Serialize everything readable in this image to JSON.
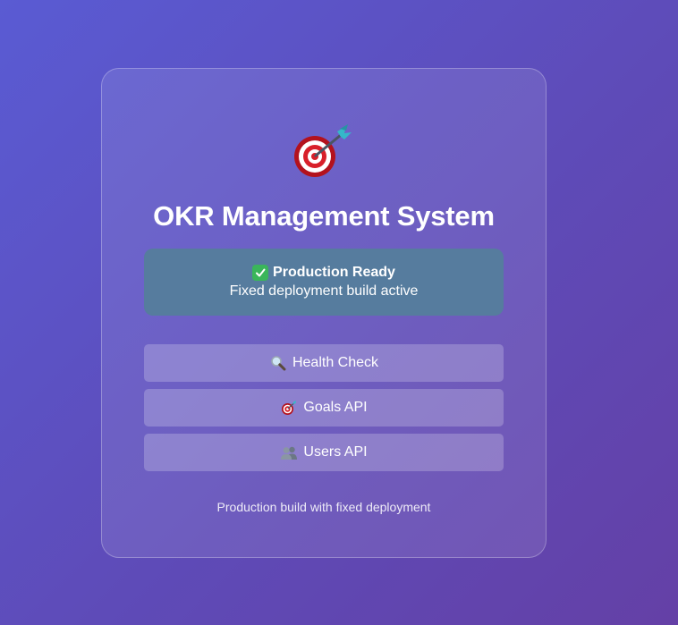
{
  "app": {
    "title": "OKR Management System",
    "logo_icon": "target-dart-icon"
  },
  "status": {
    "icon": "check-mark-icon",
    "heading": "Production Ready",
    "subtext": "Fixed deployment build active",
    "background": "#567c9e"
  },
  "buttons": [
    {
      "icon": "magnifier-icon",
      "label": "Health Check"
    },
    {
      "icon": "target-dart-icon",
      "label": "Goals API"
    },
    {
      "icon": "users-icon",
      "label": "Users API"
    }
  ],
  "footer": {
    "text": "Production build with fixed deployment"
  },
  "colors": {
    "background_start": "#5a5bd3",
    "background_end": "#6440a6",
    "success": "#3ab65a"
  }
}
